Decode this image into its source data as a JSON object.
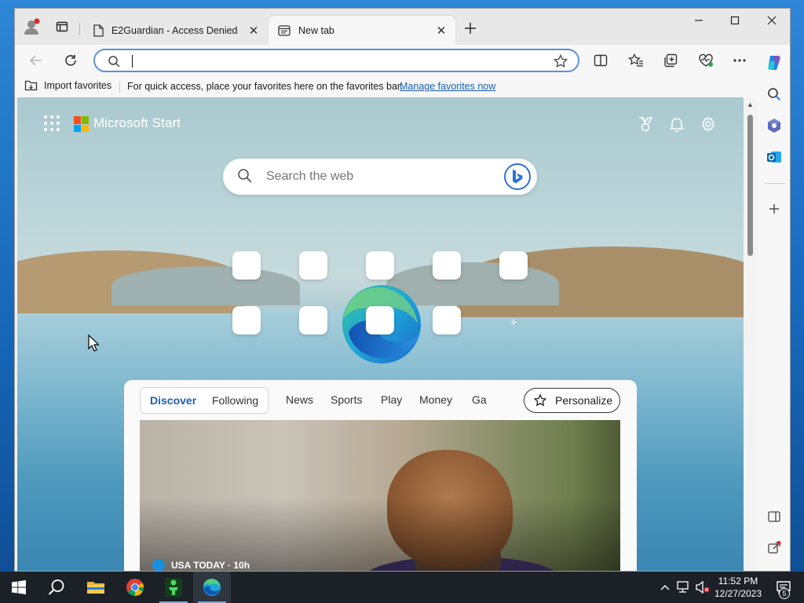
{
  "browser": {
    "tabs": [
      {
        "title": "E2Guardian - Access Denied",
        "active": false
      },
      {
        "title": "New tab",
        "active": true
      }
    ],
    "address_bar": {
      "value": "",
      "placeholder": ""
    },
    "favorites_bar": {
      "import_label": "Import favorites",
      "message": "For quick access, place your favorites here on the favorites bar.",
      "manage_link": "Manage favorites now"
    }
  },
  "new_tab_page": {
    "brand": "Microsoft Start",
    "search_placeholder": "Search the web",
    "feed": {
      "pills": [
        "Discover",
        "Following"
      ],
      "tabs": [
        "News",
        "Sports",
        "Play",
        "Money",
        "Ga"
      ],
      "personalize_label": "Personalize",
      "card": {
        "source": "USA TODAY · 10h"
      }
    }
  },
  "taskbar": {
    "clock_time": "11:52 PM",
    "clock_date": "12/27/2023",
    "notification_count": "5"
  },
  "colors": {
    "accent": "#1a5fb4",
    "omnibox_border": "#5b8fd8",
    "taskbar": "#1c2128"
  }
}
